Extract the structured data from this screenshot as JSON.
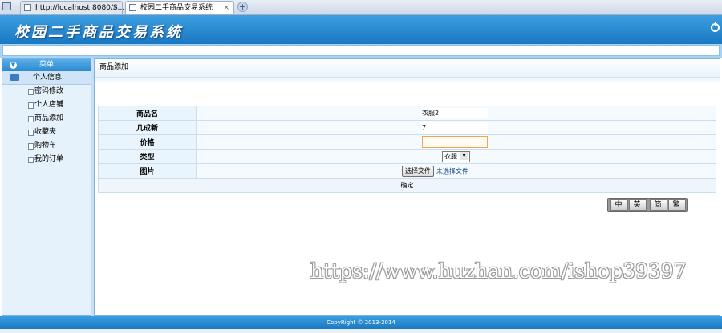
{
  "browser": {
    "tabs": [
      {
        "label": "http://localhost:8080/S...",
        "close": "×"
      },
      {
        "label": "校园二手商品交易系统",
        "close": "×"
      }
    ],
    "new_tab": "+"
  },
  "header": {
    "title": "校园二手商品交易系统"
  },
  "sidebar": {
    "head": "菜单",
    "head_icon": "▼",
    "group": "个人信息",
    "items": [
      {
        "label": "密码修改"
      },
      {
        "label": "个人店铺"
      },
      {
        "label": "商品添加"
      },
      {
        "label": "收藏夹"
      },
      {
        "label": "购物车"
      },
      {
        "label": "我的订单"
      }
    ]
  },
  "main": {
    "breadcrumb": "商品添加",
    "form": {
      "name_label": "商品名",
      "name_value": "衣服2",
      "condition_label": "几成新",
      "condition_value": "7",
      "price_label": "价格",
      "price_value": "",
      "type_label": "类型",
      "type_value": "衣服",
      "type_arrow": "▼",
      "image_label": "图片",
      "file_button": "选择文件",
      "file_status": "未选择文件",
      "submit": "确定"
    }
  },
  "lang_switch": {
    "items": [
      "中",
      "英",
      "简",
      "繁"
    ]
  },
  "watermark": "https://www.huzhan.com/ishop39397",
  "footer": {
    "copyright": "CopyRight © 2013-2014"
  },
  "colors": {
    "header": "#1a78c2",
    "accent": "#3d9fe0",
    "price_border": "#f0a64a"
  }
}
